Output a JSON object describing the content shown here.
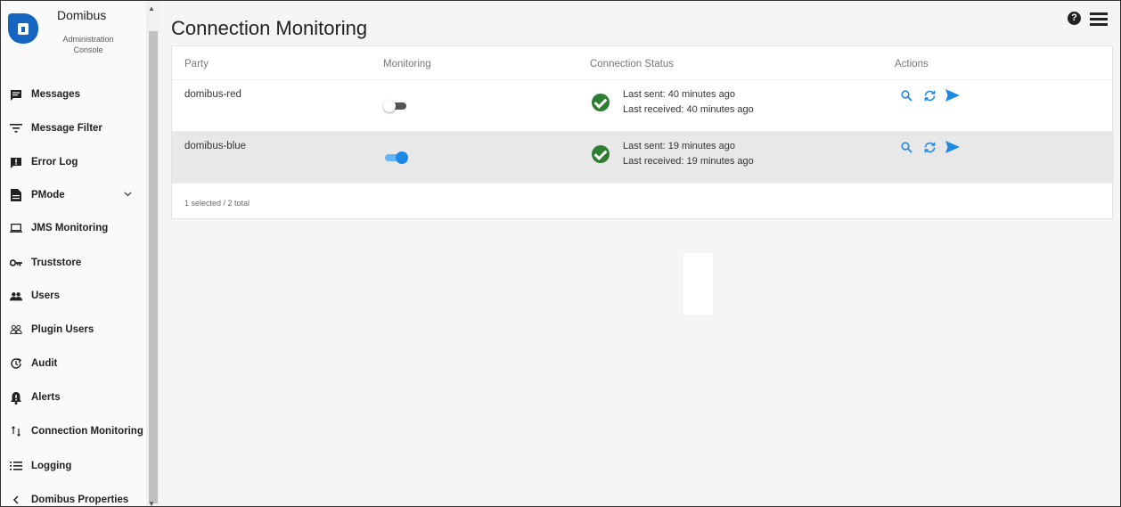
{
  "brand": {
    "title": "Domibus",
    "subtitle_line1": "Administration",
    "subtitle_line2": "Console"
  },
  "sidebar": {
    "items": [
      {
        "label": "Messages",
        "icon": "message-icon"
      },
      {
        "label": "Message Filter",
        "icon": "filter-icon"
      },
      {
        "label": "Error Log",
        "icon": "error-log-icon"
      },
      {
        "label": "PMode",
        "icon": "document-icon",
        "expandable": true
      },
      {
        "label": "JMS Monitoring",
        "icon": "laptop-icon"
      },
      {
        "label": "Truststore",
        "icon": "key-icon"
      },
      {
        "label": "Users",
        "icon": "users-icon"
      },
      {
        "label": "Plugin Users",
        "icon": "plugin-users-icon"
      },
      {
        "label": "Audit",
        "icon": "history-icon"
      },
      {
        "label": "Alerts",
        "icon": "bell-icon"
      },
      {
        "label": "Connection Monitoring",
        "icon": "swap-vertical-icon",
        "active": true
      },
      {
        "label": "Logging",
        "icon": "list-icon"
      },
      {
        "label": "Domibus Properties",
        "icon": "chevron-left-icon"
      }
    ]
  },
  "page": {
    "title": "Connection Monitoring"
  },
  "table": {
    "headers": [
      "Party",
      "Monitoring",
      "Connection Status",
      "Actions"
    ],
    "rows": [
      {
        "party": "domibus-red",
        "monitoring": false,
        "status": "success",
        "last_sent": "Last sent: 40 minutes ago",
        "last_received": "Last received: 40 minutes ago",
        "selected": false
      },
      {
        "party": "domibus-blue",
        "monitoring": true,
        "status": "success",
        "last_sent": "Last sent: 19 minutes ago",
        "last_received": "Last received: 19 minutes ago",
        "selected": true
      }
    ],
    "footer": "1 selected / 2 total"
  },
  "colors": {
    "accent": "#1e88e5",
    "success": "#2e7d32",
    "brand": "#1565c0",
    "selected_row": "#e8e8e8"
  }
}
